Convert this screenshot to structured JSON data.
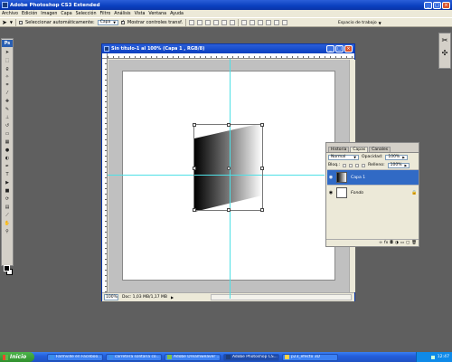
{
  "app": {
    "title": "Adobe Photoshop CS3 Extended"
  },
  "menu": [
    "Archivo",
    "Edición",
    "Imagen",
    "Capa",
    "Selección",
    "Filtro",
    "Análisis",
    "Vista",
    "Ventana",
    "Ayuda"
  ],
  "options": {
    "auto_select_label": "Seleccionar automáticamente:",
    "auto_select_value": "Capa",
    "show_transform_label": "Mostrar controles transf.",
    "workspace_label": "Espacio de trabajo"
  },
  "document": {
    "title": "Sin título-1 al 100% (Capa 1 , RGB/8)",
    "zoom": "100%",
    "doc_info": "Doc: 1,03 MB/1,17 MB"
  },
  "layers_panel": {
    "tabs": [
      "Historia",
      "Capas",
      "Canales"
    ],
    "active_tab": "Capas",
    "blend_mode": "Normal",
    "opacity_label": "Opacidad:",
    "opacity_value": "100%",
    "lock_label": "Bloq.:",
    "fill_label": "Relleno:",
    "fill_value": "100%",
    "layers": [
      {
        "name": "Capa 1",
        "active": true
      },
      {
        "name": "Fondo",
        "active": false
      }
    ]
  },
  "taskbar": {
    "start_label": "Inicio",
    "tasks": [
      "Farmville en Faceboo...",
      "carretera solitaria co...",
      "Adobe Dreamweaver ...",
      "Adobe Photoshop CS...",
      "p23_efecto 3D"
    ],
    "active_task": "Adobe Photoshop CS...",
    "clock": "12:47"
  },
  "colors": {
    "title_blue": "#0a3fbf",
    "selection_blue": "#316ac5",
    "guide_cyan": "#4ee0e6",
    "taskbar_blue": "#245edb",
    "start_green": "#2f8f2d"
  }
}
